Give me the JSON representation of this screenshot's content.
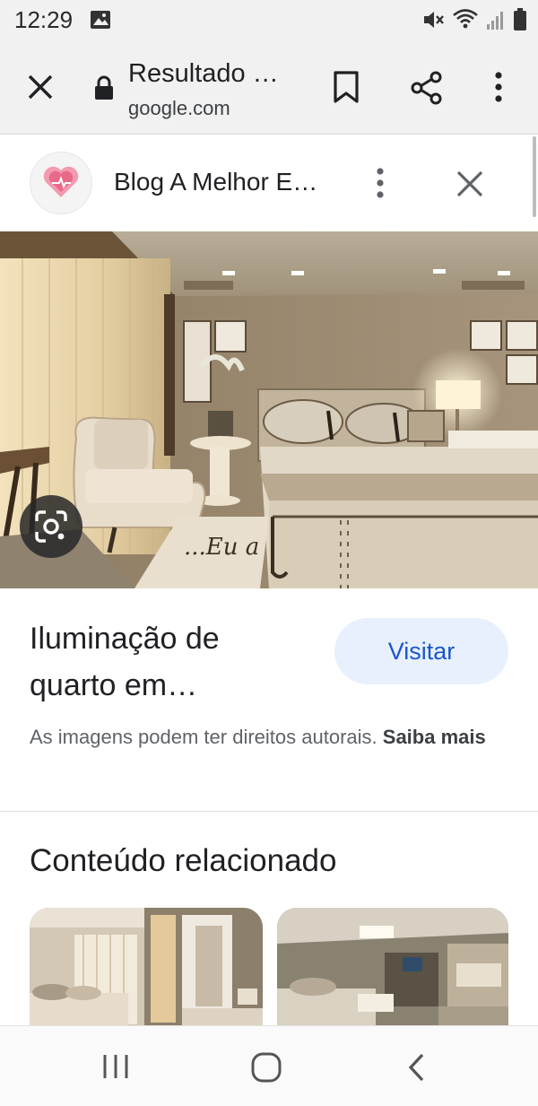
{
  "status_bar": {
    "time": "12:29",
    "icons": [
      "gallery-icon",
      "mute-icon",
      "wifi-icon",
      "signal-icon",
      "battery-icon"
    ]
  },
  "toolbar": {
    "title": "Resultado …",
    "domain": "google.com",
    "icons": [
      "close-icon",
      "lock-icon",
      "bookmark-icon",
      "share-icon",
      "more-vert-icon"
    ]
  },
  "source": {
    "name": "Blog A Melhor E…",
    "icons": [
      "favicon-heart-icon",
      "more-vert-icon",
      "close-icon"
    ]
  },
  "image": {
    "caption_text": "...Eu a"
  },
  "result": {
    "title": "Iluminação de quarto em…",
    "visit_label": "Visitar",
    "copyright_text": "As imagens podem ter direitos autorais.",
    "learn_more": "Saiba mais"
  },
  "related": {
    "heading": "Conteúdo relacionado"
  },
  "colors": {
    "chrome_bg": "#f1f1f1",
    "visit_bg": "#e8f0fe",
    "visit_text": "#1a56c9",
    "favicon_pink": "#e86a8a"
  }
}
